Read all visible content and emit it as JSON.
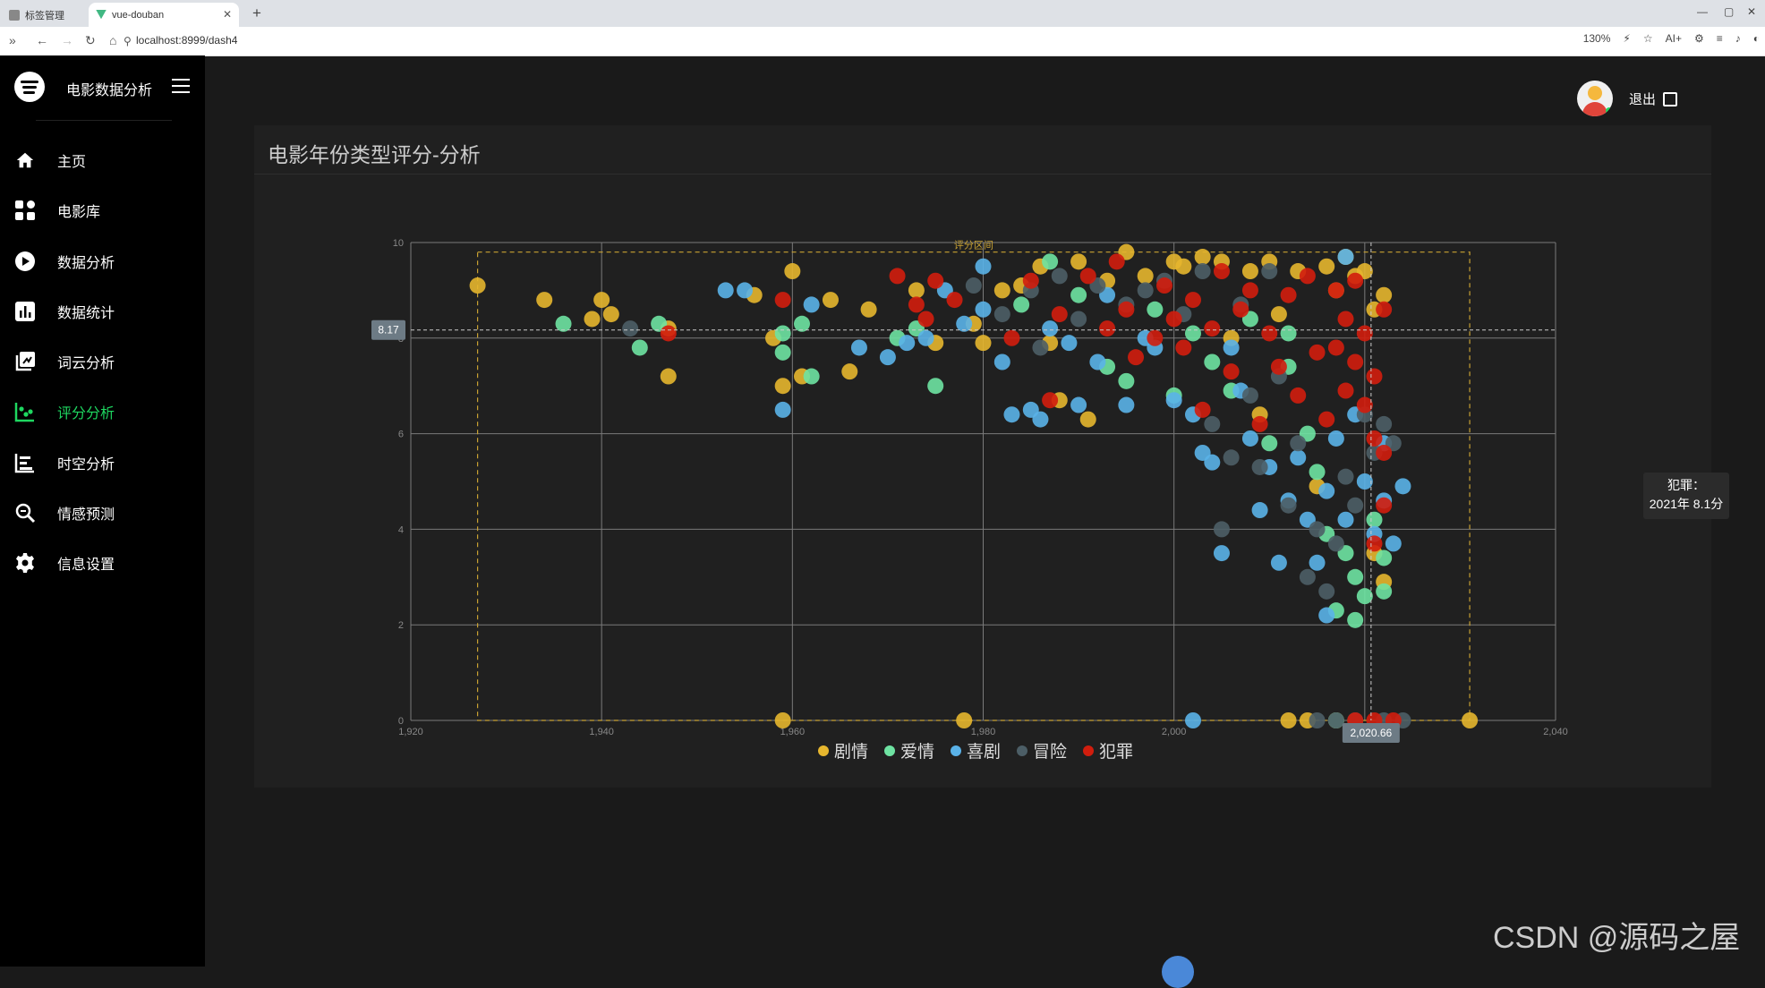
{
  "browser": {
    "tab_inactive": "标签管理",
    "tab_active": "vue-douban",
    "url": "localhost:8999/dash4",
    "zoom": "130%",
    "ai_label": "AI+"
  },
  "sidebar": {
    "brand": "电影数据分析",
    "items": [
      {
        "label": "主页",
        "icon": "home-icon"
      },
      {
        "label": "电影库",
        "icon": "grid-icon"
      },
      {
        "label": "数据分析",
        "icon": "play-icon"
      },
      {
        "label": "数据统计",
        "icon": "bar-chart-icon"
      },
      {
        "label": "词云分析",
        "icon": "wordcloud-icon"
      },
      {
        "label": "评分分析",
        "icon": "scatter-icon",
        "active": true
      },
      {
        "label": "时空分析",
        "icon": "timeline-icon"
      },
      {
        "label": "情感预测",
        "icon": "search-doc-icon"
      },
      {
        "label": "信息设置",
        "icon": "gear-icon"
      }
    ],
    "active_color": "#1ed760"
  },
  "header": {
    "logout": "退出"
  },
  "card": {
    "title": "电影年份类型评分-分析"
  },
  "tooltip": {
    "line1": "犯罪：",
    "line2": "2021年 8.1分"
  },
  "watermark": "CSDN @源码之屋",
  "chart_data": {
    "type": "scatter",
    "xlim": [
      1920,
      2040
    ],
    "ylim": [
      0,
      10
    ],
    "x_ticks": [
      1920,
      1940,
      1960,
      1980,
      2000,
      2020,
      2040
    ],
    "x_tick_labels": [
      "1,920",
      "1,940",
      "1,960",
      "1,980",
      "2,000",
      "2,020",
      "2,040"
    ],
    "y_ticks": [
      0,
      2,
      4,
      6,
      8,
      10
    ],
    "y_tick_labels": [
      "0",
      "2",
      "4",
      "6",
      "8",
      "10"
    ],
    "grid": true,
    "mark_area_label": "评分区间",
    "mark_area": {
      "x": [
        1927,
        2031
      ],
      "y": [
        0,
        9.8
      ]
    },
    "crosshair": {
      "x": 2020.66,
      "y": 8.17,
      "x_label": "2,020.66",
      "y_label": "8.17"
    },
    "legend": "bottom-center",
    "series": [
      {
        "name": "剧情",
        "color": "#e6b62e",
        "points": [
          [
            1927,
            9.1
          ],
          [
            1934,
            8.8
          ],
          [
            1940,
            8.8
          ],
          [
            1941,
            8.5
          ],
          [
            1939,
            8.4
          ],
          [
            1947,
            8.2
          ],
          [
            1947,
            7.2
          ],
          [
            1956,
            8.9
          ],
          [
            1958,
            8.0
          ],
          [
            1959,
            7.0
          ],
          [
            1959,
            0
          ],
          [
            1960,
            9.4
          ],
          [
            1961,
            7.2
          ],
          [
            1964,
            8.8
          ],
          [
            1966,
            7.3
          ],
          [
            1968,
            8.6
          ],
          [
            1973,
            9.0
          ],
          [
            1975,
            7.9
          ],
          [
            1978,
            0
          ],
          [
            1979,
            8.3
          ],
          [
            1980,
            7.9
          ],
          [
            1982,
            9.0
          ],
          [
            1984,
            9.1
          ],
          [
            1986,
            9.5
          ],
          [
            1987,
            7.9
          ],
          [
            1988,
            6.7
          ],
          [
            1990,
            9.6
          ],
          [
            1991,
            6.3
          ],
          [
            1993,
            9.2
          ],
          [
            1995,
            9.8
          ],
          [
            1997,
            9.3
          ],
          [
            2000,
            9.6
          ],
          [
            2001,
            9.5
          ],
          [
            2003,
            9.7
          ],
          [
            2005,
            9.6
          ],
          [
            2006,
            8.0
          ],
          [
            2008,
            9.4
          ],
          [
            2009,
            6.4
          ],
          [
            2010,
            9.6
          ],
          [
            2011,
            8.5
          ],
          [
            2012,
            0
          ],
          [
            2013,
            9.4
          ],
          [
            2014,
            0
          ],
          [
            2015,
            4.9
          ],
          [
            2016,
            9.5
          ],
          [
            2017,
            9.0
          ],
          [
            2017,
            0
          ],
          [
            2018,
            9.7
          ],
          [
            2019,
            9.3
          ],
          [
            2020,
            9.4
          ],
          [
            2021,
            8.6
          ],
          [
            2021,
            3.5
          ],
          [
            2022,
            8.9
          ],
          [
            2022,
            2.9
          ],
          [
            2031,
            0
          ]
        ]
      },
      {
        "name": "爱情",
        "color": "#6ee3a2",
        "points": [
          [
            1936,
            8.3
          ],
          [
            1944,
            7.8
          ],
          [
            1946,
            8.3
          ],
          [
            1959,
            7.7
          ],
          [
            1959,
            8.1
          ],
          [
            1961,
            8.3
          ],
          [
            1962,
            7.2
          ],
          [
            1971,
            8.0
          ],
          [
            1973,
            8.2
          ],
          [
            1975,
            7.0
          ],
          [
            1984,
            8.7
          ],
          [
            1987,
            9.6
          ],
          [
            1990,
            8.9
          ],
          [
            1993,
            7.4
          ],
          [
            1995,
            7.1
          ],
          [
            1998,
            8.6
          ],
          [
            2000,
            6.8
          ],
          [
            2002,
            8.1
          ],
          [
            2004,
            7.5
          ],
          [
            2006,
            6.9
          ],
          [
            2008,
            8.4
          ],
          [
            2010,
            5.8
          ],
          [
            2012,
            7.4
          ],
          [
            2014,
            6.0
          ],
          [
            2015,
            5.2
          ],
          [
            2016,
            3.9
          ],
          [
            2017,
            0
          ],
          [
            2017,
            2.3
          ],
          [
            2018,
            3.5
          ],
          [
            2019,
            3.0
          ],
          [
            2019,
            2.1
          ],
          [
            2020,
            2.6
          ],
          [
            2021,
            4.2
          ],
          [
            2022,
            2.7
          ],
          [
            2022,
            3.4
          ],
          [
            2012,
            8.1
          ]
        ]
      },
      {
        "name": "喜剧",
        "color": "#5ab2e8",
        "points": [
          [
            1953,
            9.0
          ],
          [
            1955,
            9.0
          ],
          [
            1959,
            6.5
          ],
          [
            1962,
            8.7
          ],
          [
            1967,
            7.8
          ],
          [
            1970,
            7.6
          ],
          [
            1972,
            7.9
          ],
          [
            1974,
            8.0
          ],
          [
            1976,
            9.0
          ],
          [
            1978,
            8.3
          ],
          [
            1980,
            8.6
          ],
          [
            1980,
            9.5
          ],
          [
            1982,
            7.5
          ],
          [
            1983,
            6.4
          ],
          [
            1985,
            6.5
          ],
          [
            1986,
            6.3
          ],
          [
            1987,
            8.2
          ],
          [
            1989,
            7.9
          ],
          [
            1990,
            6.6
          ],
          [
            1992,
            7.5
          ],
          [
            1993,
            8.9
          ],
          [
            1995,
            6.6
          ],
          [
            1997,
            8.0
          ],
          [
            1998,
            7.8
          ],
          [
            2000,
            6.7
          ],
          [
            2002,
            0
          ],
          [
            2002,
            6.4
          ],
          [
            2003,
            5.6
          ],
          [
            2004,
            5.4
          ],
          [
            2005,
            3.5
          ],
          [
            2006,
            7.8
          ],
          [
            2007,
            6.9
          ],
          [
            2008,
            5.9
          ],
          [
            2009,
            4.4
          ],
          [
            2010,
            5.3
          ],
          [
            2011,
            3.3
          ],
          [
            2012,
            4.6
          ],
          [
            2013,
            5.5
          ],
          [
            2014,
            4.2
          ],
          [
            2015,
            3.3
          ],
          [
            2016,
            4.8
          ],
          [
            2016,
            2.2
          ],
          [
            2017,
            5.9
          ],
          [
            2018,
            4.2
          ],
          [
            2018,
            9.7
          ],
          [
            2019,
            6.4
          ],
          [
            2020,
            5.0
          ],
          [
            2021,
            3.9
          ],
          [
            2022,
            4.6
          ],
          [
            2022,
            5.8
          ],
          [
            2024,
            4.9
          ],
          [
            2023,
            3.7
          ]
        ]
      },
      {
        "name": "冒险",
        "color": "#4c5e66",
        "points": [
          [
            1943,
            8.2
          ],
          [
            1979,
            9.1
          ],
          [
            1982,
            8.5
          ],
          [
            1985,
            9.0
          ],
          [
            1986,
            7.8
          ],
          [
            1988,
            9.3
          ],
          [
            1990,
            8.4
          ],
          [
            1992,
            9.1
          ],
          [
            1995,
            8.7
          ],
          [
            1997,
            9.0
          ],
          [
            1999,
            9.2
          ],
          [
            2001,
            8.5
          ],
          [
            2003,
            9.4
          ],
          [
            2004,
            6.2
          ],
          [
            2005,
            4.0
          ],
          [
            2006,
            5.5
          ],
          [
            2007,
            8.7
          ],
          [
            2008,
            6.8
          ],
          [
            2009,
            5.3
          ],
          [
            2010,
            9.4
          ],
          [
            2011,
            7.2
          ],
          [
            2012,
            4.5
          ],
          [
            2013,
            5.8
          ],
          [
            2014,
            3.0
          ],
          [
            2015,
            4.0
          ],
          [
            2015,
            0
          ],
          [
            2016,
            2.7
          ],
          [
            2017,
            3.7
          ],
          [
            2017,
            0
          ],
          [
            2018,
            5.1
          ],
          [
            2019,
            4.5
          ],
          [
            2019,
            0
          ],
          [
            2020,
            6.4
          ],
          [
            2021,
            5.6
          ],
          [
            2022,
            6.2
          ],
          [
            2022,
            0
          ],
          [
            2023,
            5.8
          ],
          [
            2024,
            0
          ]
        ]
      },
      {
        "name": "犯罪",
        "color": "#d11d0d",
        "points": [
          [
            1947,
            8.1
          ],
          [
            1959,
            8.8
          ],
          [
            1971,
            9.3
          ],
          [
            1973,
            8.7
          ],
          [
            1974,
            8.4
          ],
          [
            1975,
            9.2
          ],
          [
            1977,
            8.8
          ],
          [
            1983,
            8.0
          ],
          [
            1985,
            9.2
          ],
          [
            1987,
            6.7
          ],
          [
            1988,
            8.5
          ],
          [
            1991,
            9.3
          ],
          [
            1993,
            8.2
          ],
          [
            1994,
            9.6
          ],
          [
            1995,
            8.6
          ],
          [
            1996,
            7.6
          ],
          [
            1998,
            8.0
          ],
          [
            1999,
            9.1
          ],
          [
            2000,
            8.4
          ],
          [
            2001,
            7.8
          ],
          [
            2002,
            8.8
          ],
          [
            2003,
            6.5
          ],
          [
            2004,
            8.2
          ],
          [
            2005,
            9.4
          ],
          [
            2006,
            7.3
          ],
          [
            2007,
            8.6
          ],
          [
            2008,
            9.0
          ],
          [
            2009,
            6.2
          ],
          [
            2010,
            8.1
          ],
          [
            2011,
            7.4
          ],
          [
            2012,
            8.9
          ],
          [
            2013,
            6.8
          ],
          [
            2014,
            9.3
          ],
          [
            2015,
            7.7
          ],
          [
            2016,
            6.3
          ],
          [
            2017,
            9.0
          ],
          [
            2017,
            7.8
          ],
          [
            2018,
            6.9
          ],
          [
            2018,
            8.4
          ],
          [
            2019,
            7.5
          ],
          [
            2019,
            9.2
          ],
          [
            2019,
            0
          ],
          [
            2020,
            6.6
          ],
          [
            2020,
            8.1
          ],
          [
            2021,
            7.2
          ],
          [
            2021,
            5.9
          ],
          [
            2021,
            0
          ],
          [
            2022,
            4.5
          ],
          [
            2022,
            8.6
          ],
          [
            2022,
            5.6
          ],
          [
            2023,
            0
          ],
          [
            2021,
            3.7
          ]
        ]
      }
    ]
  }
}
